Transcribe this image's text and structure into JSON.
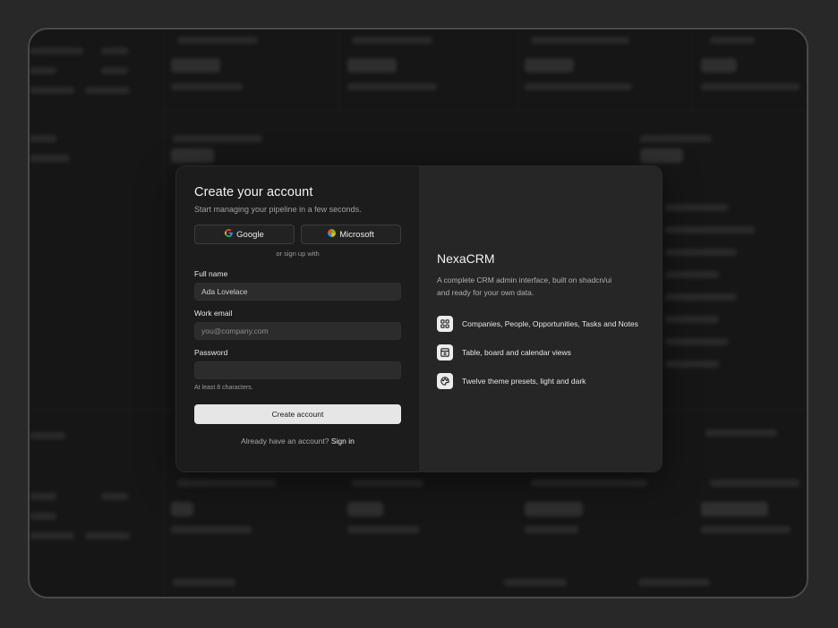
{
  "dialog": {
    "title": "Create your account",
    "subtitle": "Start managing your pipeline in a few seconds.",
    "oauth": [
      {
        "label": "Google",
        "icon": "google-icon"
      },
      {
        "label": "Microsoft",
        "icon": "microsoft-icon"
      }
    ],
    "divider": "or sign up with",
    "fields": {
      "full_name": {
        "label": "Full name",
        "value": "Ada Lovelace"
      },
      "work_email": {
        "label": "Work email",
        "placeholder": "you@company.com"
      },
      "password": {
        "label": "Password",
        "hint": "At least 8 characters."
      }
    },
    "submit_label": "Create account",
    "signin_prompt": "Already have an account?",
    "signin_link": "Sign in"
  },
  "brand_panel": {
    "name": "NexaCRM",
    "description": "A complete CRM admin interface, built on shadcn/ui and ready for your own data.",
    "features": [
      {
        "icon": "grid-icon",
        "text": "Companies, People, Opportunities, Tasks and Notes"
      },
      {
        "icon": "calendar-board-icon",
        "text": "Table, board and calendar views"
      },
      {
        "icon": "palette-icon",
        "text": "Twelve theme presets, light and dark"
      }
    ]
  },
  "colors": {
    "page_bg": "#282828",
    "frame_bg": "#161616",
    "form_panel": "#1c1c1c",
    "brand_panel": "#262626",
    "primary_button": "#e6e6e6",
    "google": [
      "#4285F4",
      "#EA4335",
      "#FBBC05",
      "#34A853"
    ],
    "microsoft": [
      "#F25022",
      "#7FBA00",
      "#00A4EF",
      "#FFB900"
    ]
  }
}
